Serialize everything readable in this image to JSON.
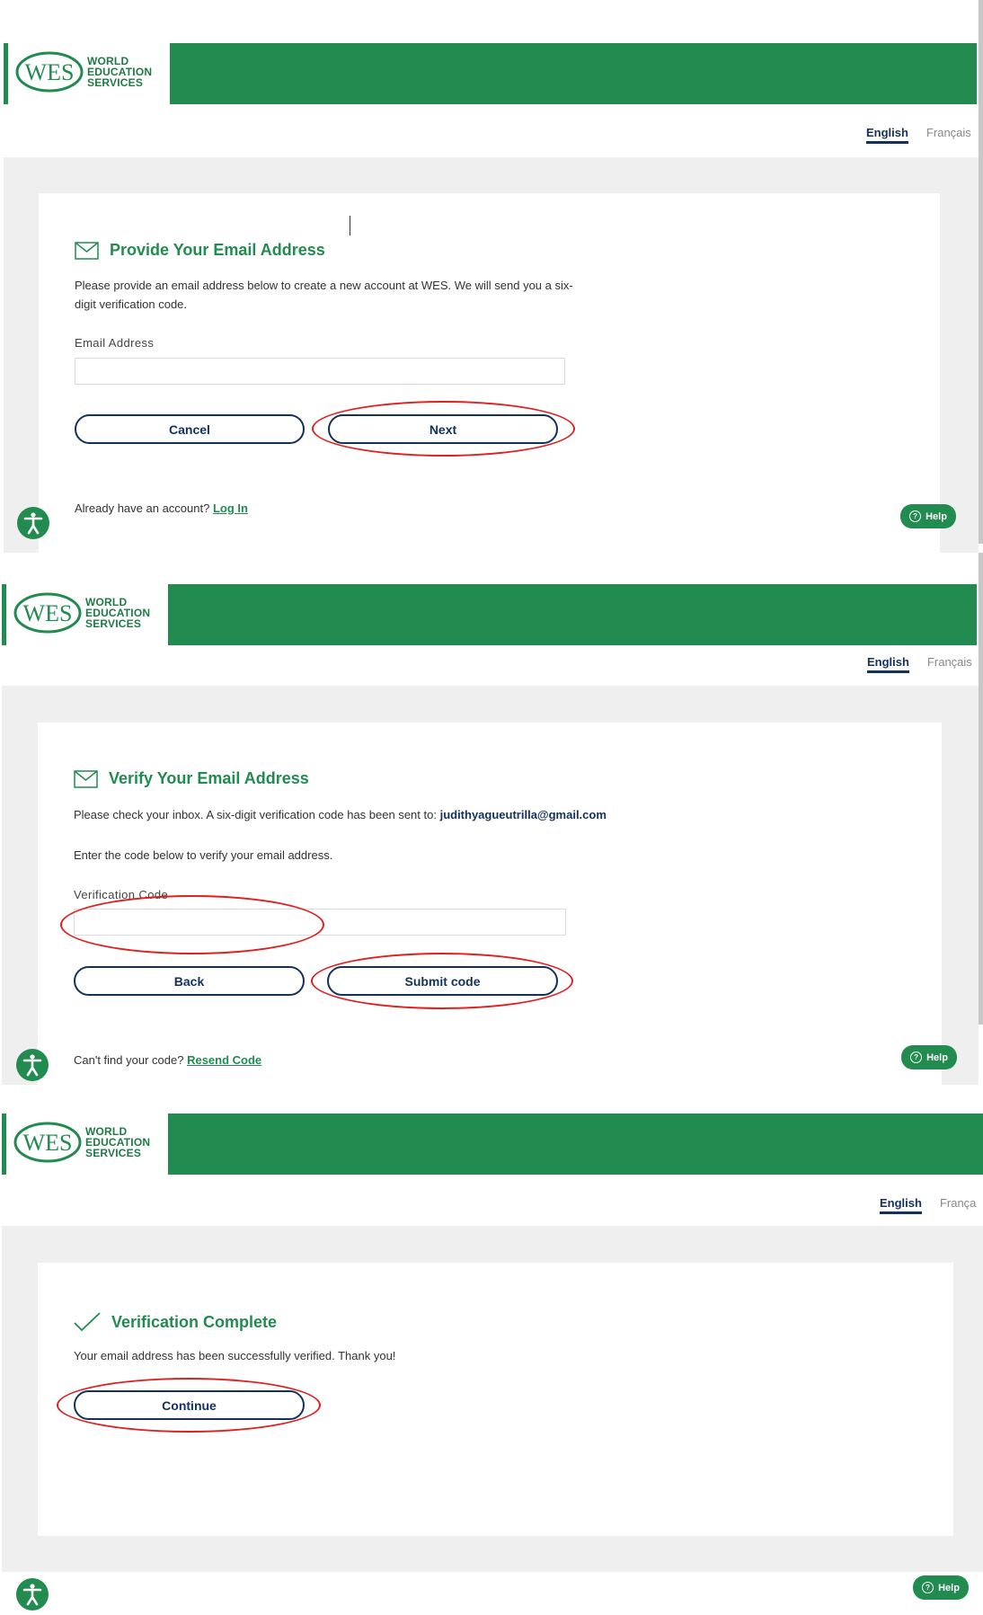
{
  "brand": {
    "logo_mark": "WES",
    "logo_words": [
      "WORLD",
      "EDUCATION",
      "SERVICES"
    ],
    "green": "#228b50",
    "navy": "#14315a",
    "annotation_red": "#e02020"
  },
  "languages": {
    "english": "English",
    "french": "Français",
    "french_truncated": "França"
  },
  "screen1": {
    "title": "Provide Your Email Address",
    "icon": "envelope-icon",
    "instructions": "Please provide an email address below to create a new account at WES. We will send you a six-digit verification code.",
    "email_label": "Email Address",
    "email_value": "",
    "cancel_label": "Cancel",
    "next_label": "Next",
    "account_prompt": "Already have an account?",
    "login_link": "Log In",
    "help_label": "Help"
  },
  "screen2": {
    "title": "Verify Your Email Address",
    "icon": "envelope-icon",
    "inbox_text": "Please check your inbox. A six-digit verification code has been sent to:",
    "email": "judithyagueutrilla@gmail.com",
    "enter_text": "Enter the code below to verify your email address.",
    "code_label": "Verification Code",
    "code_value": "",
    "back_label": "Back",
    "submit_label": "Submit code",
    "resend_prompt": "Can't find your code?",
    "resend_link": "Resend Code",
    "help_label": "Help"
  },
  "screen3": {
    "title": "Verification Complete",
    "icon": "checkmark-icon",
    "message": "Your email address has been successfully verified. Thank you!",
    "continue_label": "Continue",
    "help_label": "Help"
  }
}
